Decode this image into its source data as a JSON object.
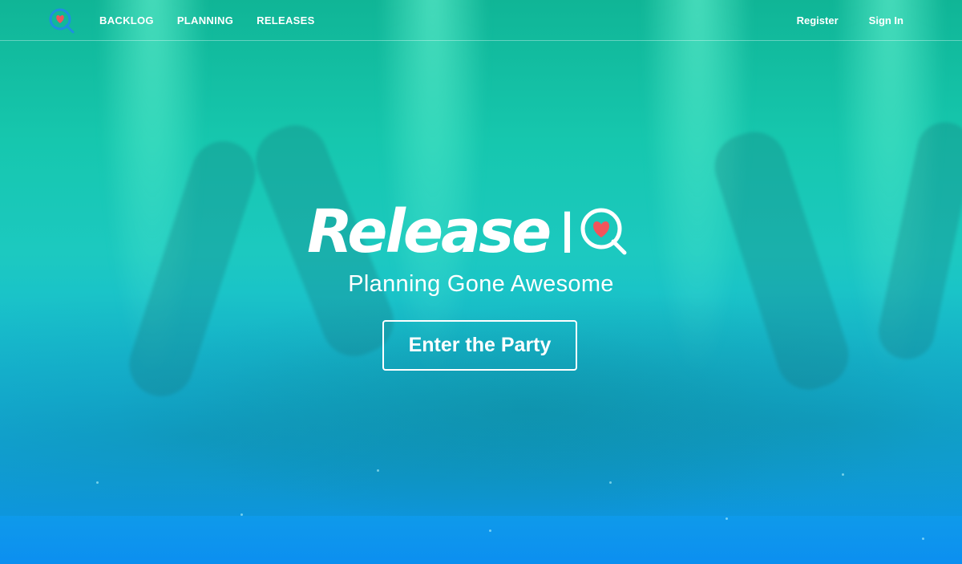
{
  "nav": {
    "logo_icon": "heart-q-logo-icon",
    "links": [
      "BACKLOG",
      "PLANNING",
      "RELEASES"
    ],
    "register": "Register",
    "sign_in": "Sign In"
  },
  "hero": {
    "brand_word": "Release",
    "brand_i": "I",
    "brand_q_icon": "heart-q-icon",
    "tagline": "Planning Gone Awesome",
    "cta": "Enter the Party"
  },
  "colors": {
    "gradient_top": "#10b596",
    "gradient_mid": "#1cc9c0",
    "gradient_bottom": "#0c8ff0",
    "heart": "#f2545b",
    "logo_ring": "#1e8fe0"
  }
}
